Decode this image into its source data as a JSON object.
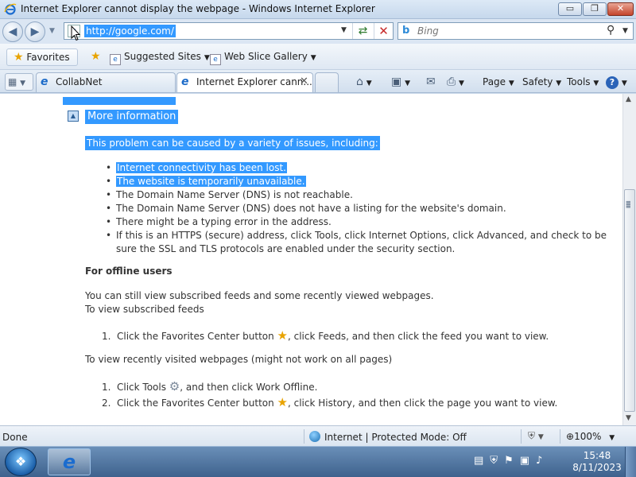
{
  "window": {
    "title": "Internet Explorer cannot display the webpage - Windows Internet Explorer",
    "controls": {
      "minimize": "▭",
      "maximize": "❐",
      "close": "✕"
    }
  },
  "address_bar": {
    "url": "http://google.com/",
    "search_placeholder": "Bing",
    "icons": [
      "back-icon",
      "forward-icon",
      "refresh-icon",
      "stop-icon",
      "search-icon"
    ]
  },
  "favorites_bar": {
    "favorites_label": "Favorites",
    "items": [
      {
        "label": "Suggested Sites"
      },
      {
        "label": "Web Slice Gallery"
      }
    ]
  },
  "tabs": [
    {
      "label": "CollabNet",
      "active": false
    },
    {
      "label": "Internet Explorer cann...",
      "active": true
    }
  ],
  "command_bar": {
    "page": "Page",
    "safety": "Safety",
    "tools": "Tools"
  },
  "content": {
    "more_information": "More information",
    "problem_intro": "This problem can be caused by a variety of issues, including:",
    "causes": [
      {
        "text": "Internet connectivity has been lost.",
        "selected": true
      },
      {
        "text": "The website is temporarily unavailable.",
        "selected": true
      },
      {
        "text": "The Domain Name Server (DNS) is not reachable.",
        "selected": false
      },
      {
        "text": "The Domain Name Server (DNS) does not have a listing for the website's domain.",
        "selected": false
      },
      {
        "text": "There might be a typing error in the address.",
        "selected": false
      },
      {
        "text": "If this is an HTTPS (secure) address, click Tools, click Internet Options, click Advanced, and check to be sure the SSL and TLS protocols are enabled under the security section.",
        "selected": false
      }
    ],
    "offline_heading": "For offline users",
    "offline_line1": "You can still view subscribed feeds and some recently viewed webpages.",
    "offline_line2": "To view subscribed feeds",
    "feeds_step": {
      "num": "1.",
      "before": "Click the Favorites Center button",
      "after": ", click Feeds, and then click the feed you want to view."
    },
    "recent_intro": "To view recently visited webpages (might not work on all pages)",
    "recent_steps": [
      {
        "num": "1.",
        "before": "Click Tools",
        "icon": "gear-icon",
        "after": ", and then click Work Offline."
      },
      {
        "num": "2.",
        "before": "Click the Favorites Center button",
        "icon": "favorites-star-icon",
        "after": ", click History, and then click the page you want to view."
      }
    ]
  },
  "status_bar": {
    "status": "Done",
    "zone": "Internet | Protected Mode: Off",
    "zoom": "100%"
  },
  "taskbar": {
    "time": "15:48",
    "date": "8/11/2023"
  },
  "colors": {
    "selection": "#3399ff",
    "chrome": "#dbe6f3",
    "taskbar": "#4a6f9a"
  }
}
